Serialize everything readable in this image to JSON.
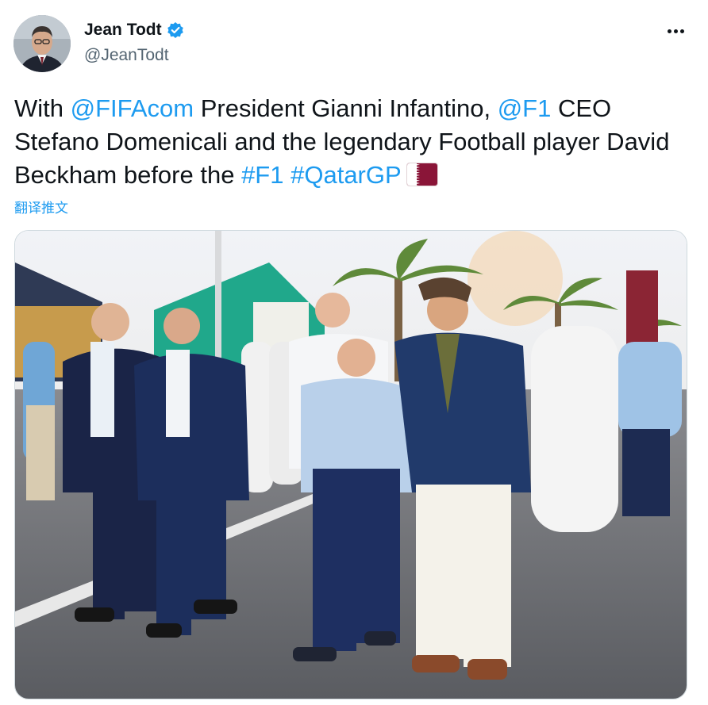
{
  "author": {
    "display_name": "Jean Todt",
    "handle": "@JeanTodt",
    "verified_icon": "verified-badge-icon",
    "avatar_icon": "avatar"
  },
  "menu": {
    "icon": "more-options-icon"
  },
  "tweet": {
    "seg1": "With ",
    "mention1": "@FIFAcom",
    "seg2": " President Gianni Infantino, ",
    "mention2": "@F1",
    "seg3": " CEO Stefano Domenicali and the legendary Football player David Beckham before the ",
    "hashtag1": "#F1",
    "seg4": " ",
    "hashtag2": "#QatarGP",
    "emoji": "qatar-flag-emoji"
  },
  "translate_label": "翻译推文",
  "media": {
    "type": "photo"
  },
  "colors": {
    "link": "#1d9bf0",
    "text": "#0f1419",
    "secondary": "#536471",
    "border": "#cfd9de"
  }
}
